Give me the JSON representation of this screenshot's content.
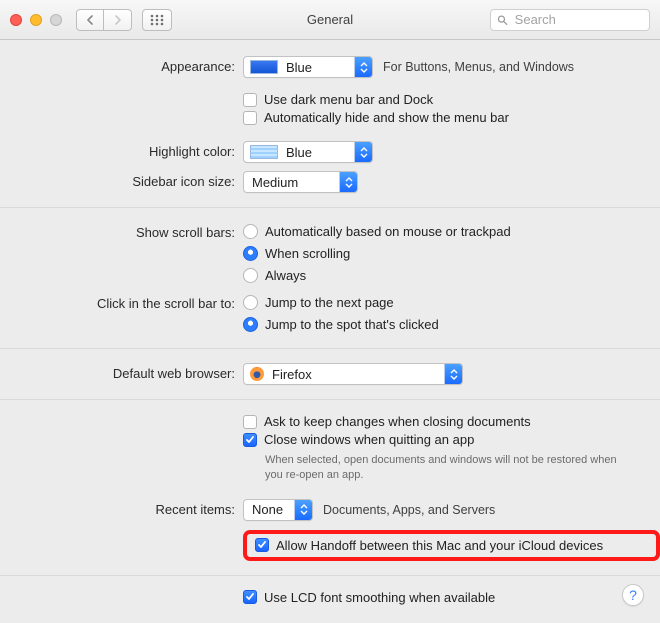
{
  "window": {
    "title": "General"
  },
  "search": {
    "placeholder": "Search"
  },
  "appearance": {
    "label": "Appearance:",
    "value": "Blue",
    "hint": "For Buttons, Menus, and Windows",
    "dark_menu": {
      "label": "Use dark menu bar and Dock",
      "checked": false
    },
    "auto_hide": {
      "label": "Automatically hide and show the menu bar",
      "checked": false
    }
  },
  "highlight": {
    "label": "Highlight color:",
    "value": "Blue"
  },
  "sidebar_size": {
    "label": "Sidebar icon size:",
    "value": "Medium"
  },
  "scrollbars": {
    "label": "Show scroll bars:",
    "options": [
      {
        "label": "Automatically based on mouse or trackpad",
        "selected": false
      },
      {
        "label": "When scrolling",
        "selected": true
      },
      {
        "label": "Always",
        "selected": false
      }
    ]
  },
  "click_scroll": {
    "label": "Click in the scroll bar to:",
    "options": [
      {
        "label": "Jump to the next page",
        "selected": false
      },
      {
        "label": "Jump to the spot that's clicked",
        "selected": true
      }
    ]
  },
  "browser": {
    "label": "Default web browser:",
    "value": "Firefox"
  },
  "documents": {
    "ask_keep": {
      "label": "Ask to keep changes when closing documents",
      "checked": false
    },
    "close_windows": {
      "label": "Close windows when quitting an app",
      "checked": true,
      "note": "When selected, open documents and windows will not be restored when you re-open an app."
    }
  },
  "recent": {
    "label": "Recent items:",
    "value": "None",
    "suffix": "Documents, Apps, and Servers"
  },
  "handoff": {
    "label": "Allow Handoff between this Mac and your iCloud devices",
    "checked": true
  },
  "font_smoothing": {
    "label": "Use LCD font smoothing when available",
    "checked": true
  },
  "help": "?"
}
